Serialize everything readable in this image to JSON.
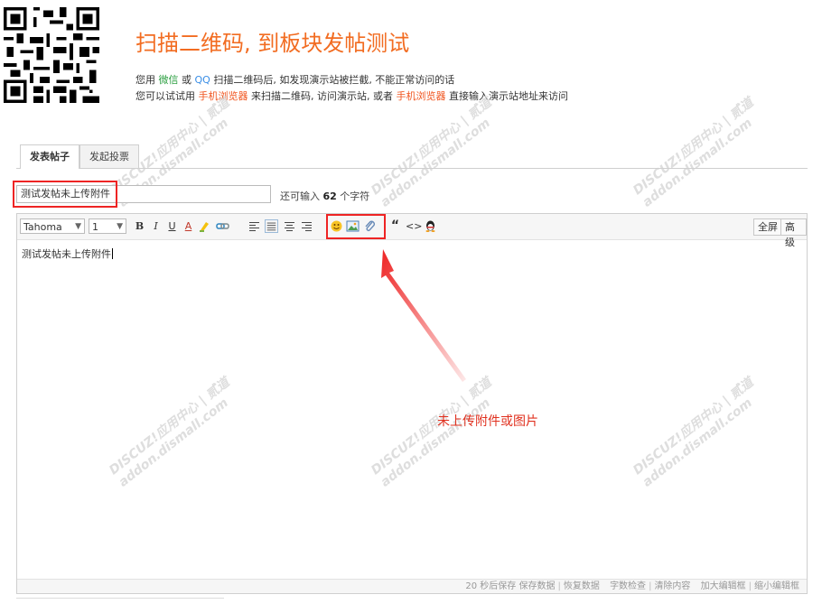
{
  "header": {
    "title": "扫描二维码, 到板块发帖测试",
    "line1": {
      "pre": "您用 ",
      "wechat": "微信",
      "or": " 或 ",
      "qq": "QQ",
      "post": " 扫描二维码后, 如发现演示站被拦截, 不能正常访问的话"
    },
    "line2": {
      "pre": "您可以试试用 ",
      "browser1": "手机浏览器",
      "mid": " 来扫描二维码, 访问演示站, 或者 ",
      "browser2": "手机浏览器",
      "post": " 直接输入演示站地址来访问"
    }
  },
  "tabs": [
    {
      "label": "发表帖子"
    },
    {
      "label": "发起投票"
    }
  ],
  "subject": {
    "value": "测试发帖未上传附件",
    "remain_pre": "还可输入 ",
    "remain_count": "62",
    "remain_post": " 个字符"
  },
  "toolbar": {
    "font": "Tahoma",
    "size": "1",
    "buttons": {
      "bold": "B",
      "italic": "I",
      "underline": "U",
      "color": "A",
      "quote": "“",
      "code": "<>"
    },
    "fullscreen": "全屏",
    "advanced": "高级"
  },
  "editor": {
    "content": "测试发帖未上传附件"
  },
  "status": {
    "autosave": "20 秒后保存",
    "save": "保存数据",
    "restore": "恢复数据",
    "check": "字数检查",
    "clear": "清除内容",
    "enlarge": "加大编辑框",
    "shrink": "缩小编辑框"
  },
  "annotation": {
    "text": "未上传附件或图片"
  },
  "watermark": {
    "text": "DISCUZ!应用中心 | 贰道",
    "sub": "addon.dismall.com"
  },
  "colors": {
    "accent": "#f26c21",
    "annotation": "#ee2424",
    "wechat": "#2ea043",
    "qq": "#3a8ee6"
  }
}
